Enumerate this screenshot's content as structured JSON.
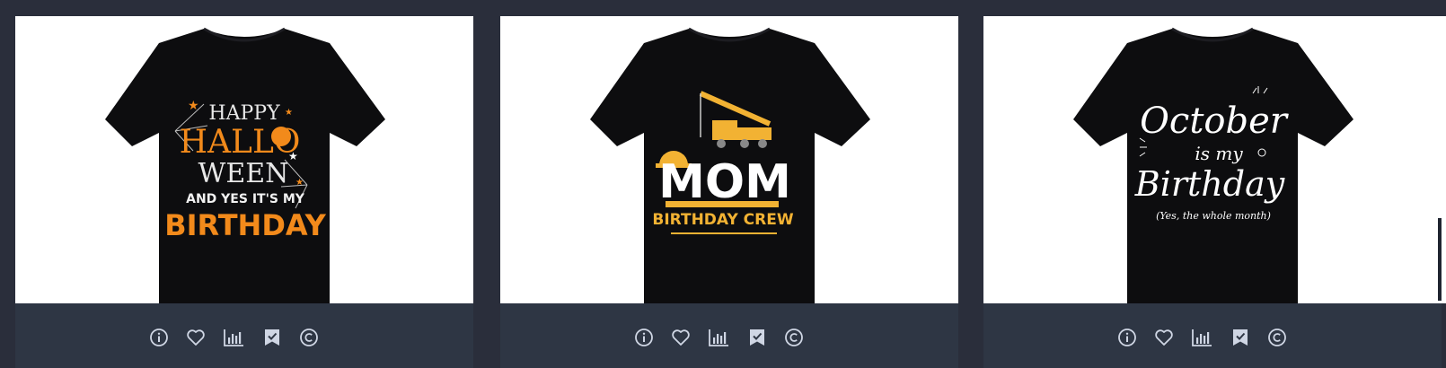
{
  "products": [
    {
      "shirt_text": {
        "line1": "HAPPY",
        "line2": "HALLO",
        "line3": "WEEN",
        "line4": "AND YES IT'S MY",
        "line5": "BIRTHDAY"
      },
      "accent_color": "#f28a1b",
      "actions": [
        "info-icon",
        "heart-icon",
        "chart-icon",
        "bookmark-check-icon",
        "copyright-icon"
      ]
    },
    {
      "shirt_text": {
        "line1": "MOM",
        "line2": "BIRTHDAY CREW"
      },
      "accent_color": "#f2b233",
      "actions": [
        "info-icon",
        "heart-icon",
        "chart-icon",
        "bookmark-check-icon",
        "copyright-icon"
      ]
    },
    {
      "shirt_text": {
        "line1": "October",
        "line2": "is my",
        "line3": "Birthday",
        "line4": "(Yes, the whole month)"
      },
      "accent_color": "#ffffff",
      "actions": [
        "info-icon",
        "heart-icon",
        "chart-icon",
        "bookmark-check-icon",
        "copyright-icon"
      ]
    }
  ],
  "colors": {
    "page_background": "#2a2e3b",
    "card_footer": "#2e3644",
    "icon": "#cfd6e4",
    "shirt": "#0d0d0f"
  }
}
